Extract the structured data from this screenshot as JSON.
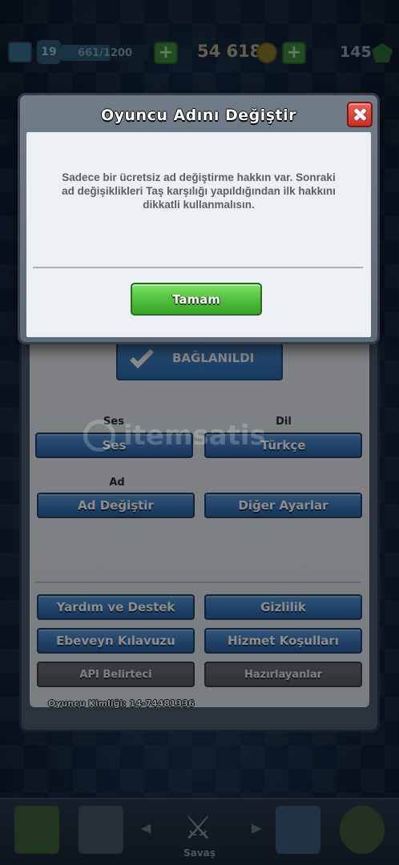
{
  "topbar": {
    "level": "19",
    "xp_progress": "661/1200",
    "xp_fraction": 0.55,
    "gold": "54 618",
    "gems": "145"
  },
  "modal": {
    "title": "Oyuncu Adını Değiştir",
    "message": "Sadece bir ücretsiz ad değiştirme hakkın var. Sonraki ad değişiklikleri Taş karşılığı yapıldığından ilk hakkını dikkatli kullanmalısın.",
    "ok_label": "Tamam"
  },
  "settings": {
    "connected_label": "BAĞLANILDI",
    "sound_heading": "Ses",
    "sound_button": "Ses",
    "language_heading": "Dil",
    "language_button": "Türkçe",
    "name_heading": "Ad",
    "change_name_button": "Ad Değiştir",
    "other_settings_button": "Diğer Ayarlar",
    "help_button": "Yardım ve Destek",
    "privacy_button": "Gizlilik",
    "parent_guide_button": "Ebeveyn Kılavuzu",
    "terms_button": "Hizmet Koşulları",
    "api_token_button": "API Belirteci",
    "credits_button": "Hazırlayanlar",
    "player_id": "Oyuncu Kimliği: 14-74481336"
  },
  "bottom_nav": {
    "battle_label": "Savaş"
  },
  "watermark": "itemsatis",
  "colors": {
    "ok_green": "#4fbe3b",
    "close_red": "#c92e26",
    "button_blue": "#3a75bd"
  },
  "icons": [
    "xp-icon",
    "plus-icon",
    "gold-coin-icon",
    "gem-icon",
    "close-icon",
    "check-icon",
    "shop-icon",
    "cards-icon",
    "battle-swords-icon",
    "clan-icon",
    "events-icon"
  ]
}
